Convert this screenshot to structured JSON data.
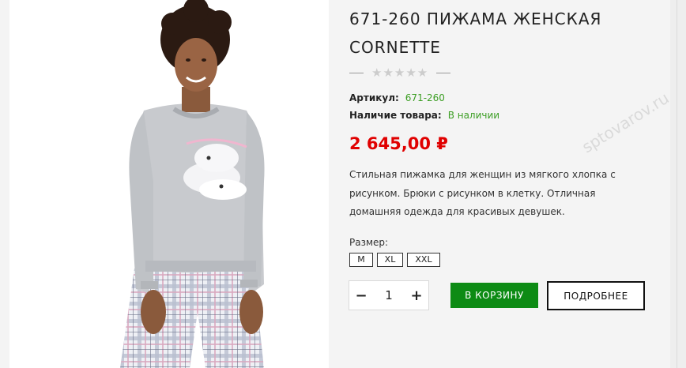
{
  "product": {
    "title": "671-260 ПИЖАМА ЖЕНСКАЯ CORNETTE",
    "rating_stars": "★★★★★",
    "sku_label": "Артикул:",
    "sku_value": "671-260",
    "availability_label": "Наличие товара:",
    "availability_value": "В наличии",
    "price": "2 645,00 ₽",
    "description": "Стильная пижамка для женщин из мягкого хлопка с рисунком. Брюки с рисунком в клетку. Отличная домашняя одежда для красивых девушек.",
    "size_label": "Размер:",
    "sizes": [
      "M",
      "XL",
      "XXL"
    ]
  },
  "purchase": {
    "minus": "−",
    "quantity": "1",
    "plus": "+",
    "add_to_cart": "В КОРЗИНУ",
    "details": "ПОДРОБНЕЕ"
  },
  "watermark": {
    "text": "sptovarov.ru"
  },
  "colors": {
    "price": "#e00000",
    "availability": "#3c9e24",
    "cart_button": "#0d8b14"
  }
}
